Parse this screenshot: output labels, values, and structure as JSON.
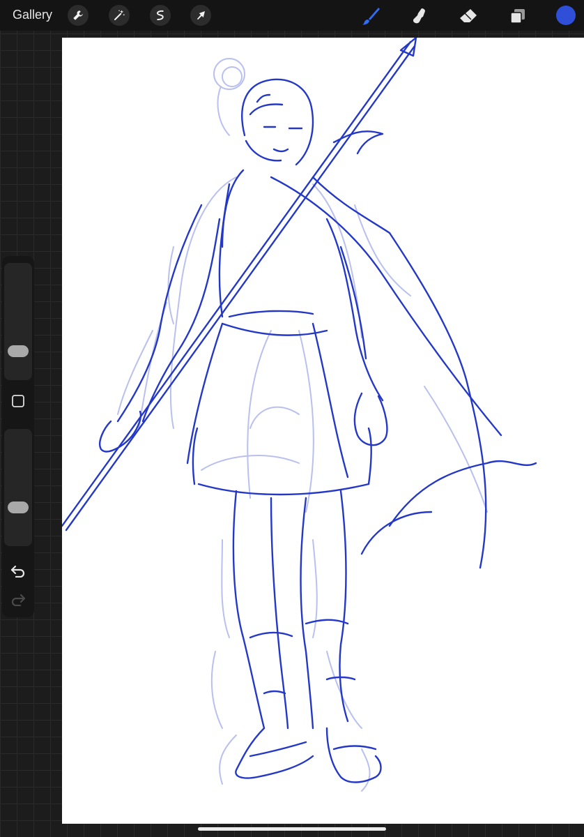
{
  "topbar": {
    "gallery_label": "Gallery",
    "left_tools": [
      "wrench-icon",
      "magic-wand-icon",
      "selection-icon",
      "transform-arrow-icon"
    ],
    "right_tools": [
      "brush-icon",
      "smudge-icon",
      "eraser-icon",
      "layers-icon"
    ],
    "active_tool": "brush-icon",
    "current_color": "#2f4fd9"
  },
  "sidebar": {
    "brush_size": 0.2,
    "brush_opacity": 0.3
  },
  "colors": {
    "accent_blue": "#2f6df6",
    "ink_blue": "#2438c8",
    "sketch_lavender": "#b9c0f0"
  }
}
